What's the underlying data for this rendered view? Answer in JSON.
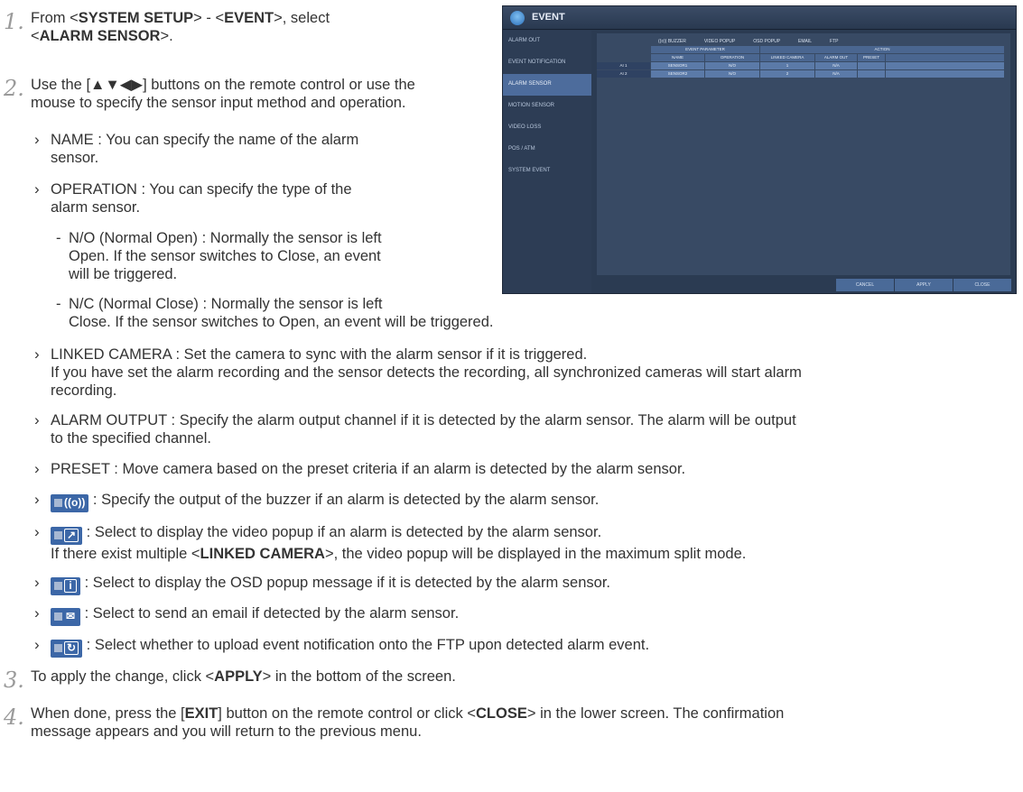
{
  "steps": [
    {
      "num": "1.",
      "line1": {
        "pre": "From <",
        "b1": "SYSTEM SETUP",
        "mid": "> - <",
        "b2": "EVENT",
        "post": ">, select"
      },
      "line2": {
        "pre": "<",
        "b1": "ALARM SENSOR",
        "post": ">."
      }
    },
    {
      "num": "2.",
      "line1": "Use the [▲▼◀▶] buttons on the remote control or use the",
      "line2": "mouse to specify the sensor input method and operation."
    },
    {
      "num": "3.",
      "pre": "To apply the change, click <",
      "b1": "APPLY",
      "post": "> in the bottom of the screen."
    },
    {
      "num": "4.",
      "pre": "When done, press the [",
      "b1": "EXIT",
      "mid": "] button on the remote control or click <",
      "b2": "CLOSE",
      "post": "> in the lower screen. The confirmation",
      "line2": "message appears and you will return to the previous menu."
    }
  ],
  "bullets": {
    "name": [
      "NAME : You can specify the name of the alarm",
      "sensor."
    ],
    "operation": [
      "OPERATION : You can specify the type of the",
      "alarm sensor."
    ],
    "no": [
      "N/O (Normal Open) : Normally the sensor is left",
      "Open. If the sensor switches to Close, an event",
      "will be triggered."
    ],
    "nc": [
      "N/C (Normal Close) : Normally the sensor is left",
      "Close. If the sensor switches to Open, an event will be triggered."
    ],
    "linked": [
      "LINKED CAMERA : Set the camera to sync with the alarm sensor if it is triggered.",
      "If you have set the alarm recording and the sensor detects the recording, all synchronized cameras will start alarm",
      "recording."
    ],
    "alarm_output": [
      "ALARM OUTPUT : Specify the alarm output channel if it is detected by the alarm sensor. The alarm will be output",
      "to the specified channel."
    ],
    "preset": "PRESET : Move camera based on the preset criteria if an alarm is detected by the alarm sensor.",
    "buzzer": ": Specify the output of the buzzer if an alarm is detected by the alarm sensor.",
    "video": ": Select to display the video popup if an alarm is detected by the alarm sensor.",
    "video2": {
      "pre": "If there exist multiple <",
      "b1": "LINKED CAMERA",
      "post": ">, the video popup will be displayed in the maximum split mode."
    },
    "osd": ": Select to display the OSD popup message if it is detected by the alarm sensor.",
    "email": ": Select to send an email if detected by the alarm sensor.",
    "ftp": ": Select whether to upload event notification onto the FTP upon detected alarm event."
  },
  "icons": {
    "buzzer": "((o))",
    "video": "↗",
    "osd": "i",
    "email": "✉",
    "ftp": "↻"
  },
  "dvr": {
    "title": "EVENT",
    "sidebar": [
      "ALARM OUT",
      "EVENT NOTIFICATION",
      "ALARM SENSOR",
      "MOTION SENSOR",
      "VIDEO LOSS",
      "POS / ATM",
      "SYSTEM EVENT"
    ],
    "legend": [
      "((o)) BUZZER",
      "VIDEO POPUP",
      "OSD POPUP",
      "EMAIL",
      "FTP"
    ],
    "group_headers": [
      "EVENT PARAMETER",
      "ACTION"
    ],
    "columns": [
      "NAME",
      "OPERATION",
      "LINKED CAMERA",
      "ALARM OUT",
      "PRESET"
    ],
    "rows": [
      {
        "id": "AI 1",
        "name": "SENSOR1",
        "op": "N/O",
        "cam": "1",
        "out": "N/A"
      },
      {
        "id": "AI 2",
        "name": "SENSOR2",
        "op": "N/O",
        "cam": "2",
        "out": "N/A"
      }
    ],
    "buttons": [
      "CANCEL",
      "APPLY",
      "CLOSE"
    ]
  }
}
